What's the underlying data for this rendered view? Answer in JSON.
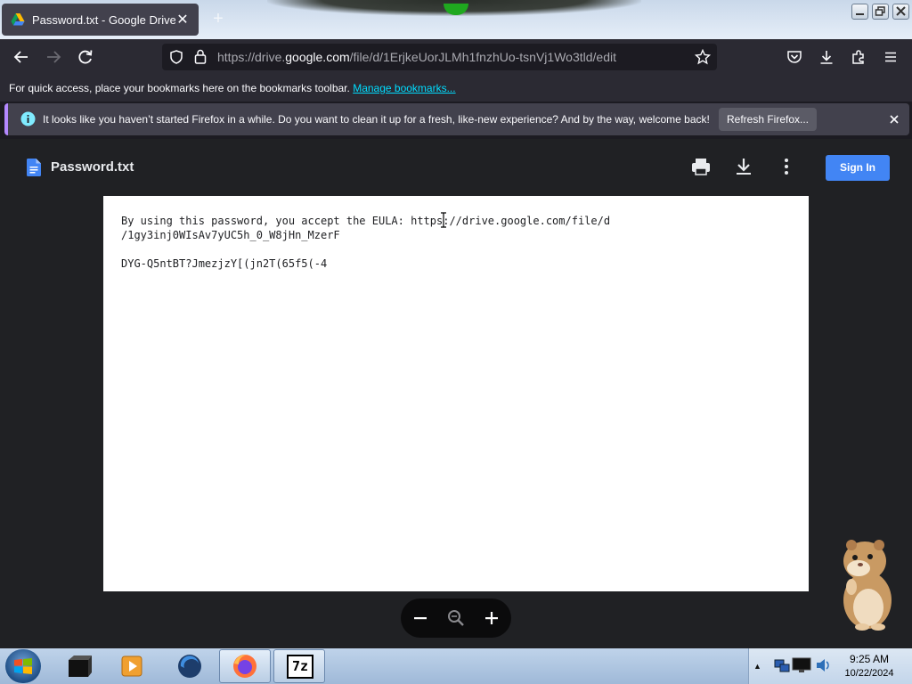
{
  "browser": {
    "tab": {
      "title": "Password.txt - Google Drive",
      "close": "✕"
    },
    "new_tab": "+",
    "url_prefix": "https://drive.",
    "url_domain": "google.com",
    "url_path": "/file/d/1ErjkeUorJLMh1fnzhUo-tsnVj1Wo3tld/edit",
    "bookmarks_text": "For quick access, place your bookmarks here on the bookmarks toolbar.",
    "bookmarks_link": "Manage bookmarks...",
    "notification": {
      "message": "It looks like you haven’t started Firefox in a while. Do you want to clean it up for a fresh, like-new experience? And by the way, welcome back!",
      "button": "Refresh Firefox...",
      "close": "✕"
    }
  },
  "drive": {
    "file_title": "Password.txt",
    "sign_in": "Sign In",
    "document_text": "By using this password, you accept the EULA: https://drive.google.com/file/d\n/1gy3inj0WIsAv7yUC5h_0_W8jHn_MzerF\n\nDYG-Q5ntBT?JmezjzY[(jn2T(65f5(-4"
  },
  "taskbar": {
    "time": "9:25 AM",
    "date": "10/22/2024",
    "tray_arrow": "▲",
    "apps": [
      "terminal-app",
      "media-player-app",
      "firefox-dev-app",
      "firefox-app",
      "7zip-app"
    ],
    "sevenzip_label": "7z"
  },
  "colors": {
    "accent_blue": "#4285f4",
    "link_cyan": "#00ddff",
    "notify_purple": "#b488ff"
  }
}
